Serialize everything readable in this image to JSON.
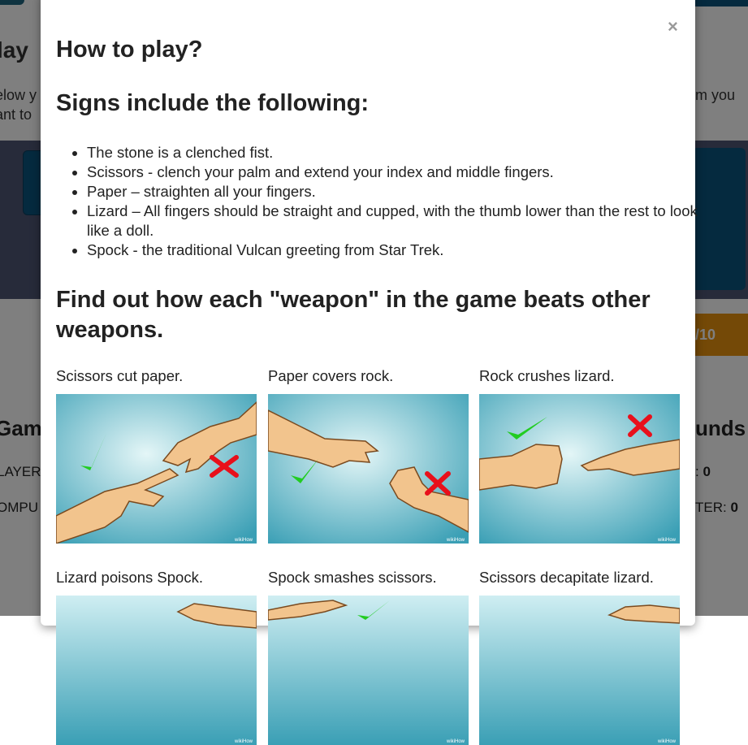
{
  "background": {
    "title_left": "lay",
    "title_right": "",
    "desc_line1": "elow y",
    "desc_line2": "ant to",
    "desc_right": "m you",
    "round_counter": "/10",
    "game_heading": "Gam",
    "rounds_heading": "unds",
    "player_label": "LAYER",
    "computer_label": "OMPU",
    "player_score_label": ": ",
    "player_score": "0",
    "computer_score_label": "TER: ",
    "computer_score": "0"
  },
  "modal": {
    "close_symbol": "×",
    "title": "How to play?",
    "signs_heading": "Signs include the following:",
    "rules": [
      "The stone is a clenched fist.",
      "Scissors - clench your palm and extend your index and middle fingers.",
      "Paper – straighten all your fingers.",
      "Lizard – All fingers should be straight and cupped, with the thumb lower than the rest to look like a doll.",
      "Spock - the traditional Vulcan greeting from Star Trek."
    ],
    "weapons_heading": "Find out how each \"weapon\" in the game beats other weapons.",
    "examples": [
      {
        "caption": "Scissors cut paper.",
        "watermark": "wikiHow"
      },
      {
        "caption": "Paper covers rock.",
        "watermark": "wikiHow"
      },
      {
        "caption": "Rock crushes lizard.",
        "watermark": "wikiHow"
      },
      {
        "caption": "Lizard poisons Spock.",
        "watermark": "wikiHow"
      },
      {
        "caption": "Spock smashes scissors.",
        "watermark": "wikiHow"
      },
      {
        "caption": "Scissors decapitate lizard.",
        "watermark": "wikiHow"
      }
    ]
  },
  "colors": {
    "illustration_bg_light": "#d9f0f3",
    "illustration_bg_dark": "#3a9fb5",
    "skin": "#f2c48d",
    "skin_outline": "#7a4a1f",
    "check_green": "#22cc22",
    "cross_red": "#e8101b"
  }
}
